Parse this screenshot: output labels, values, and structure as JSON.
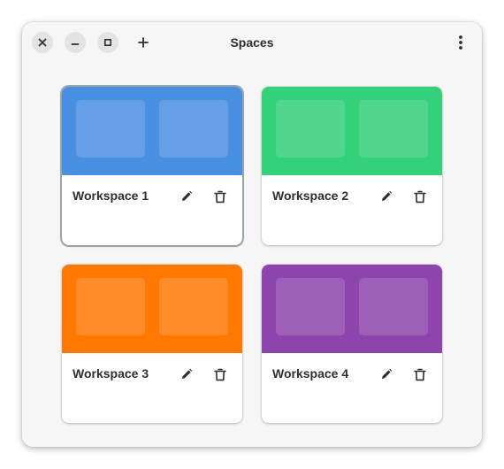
{
  "window": {
    "title": "Spaces",
    "controls": [
      "close-icon",
      "minimize-icon",
      "maximize-icon"
    ],
    "add_icon": "plus-icon",
    "menu_icon": "kebab-menu-icon"
  },
  "workspaces": [
    {
      "name": "Workspace 1",
      "color": "#4a90e2",
      "selected": true
    },
    {
      "name": "Workspace 2",
      "color": "#33d17a",
      "selected": false
    },
    {
      "name": "Workspace 3",
      "color": "#ff7800",
      "selected": false
    },
    {
      "name": "Workspace 4",
      "color": "#8e44ad",
      "selected": false
    }
  ],
  "card_actions": {
    "edit_icon": "pencil-icon",
    "delete_icon": "trash-icon"
  }
}
